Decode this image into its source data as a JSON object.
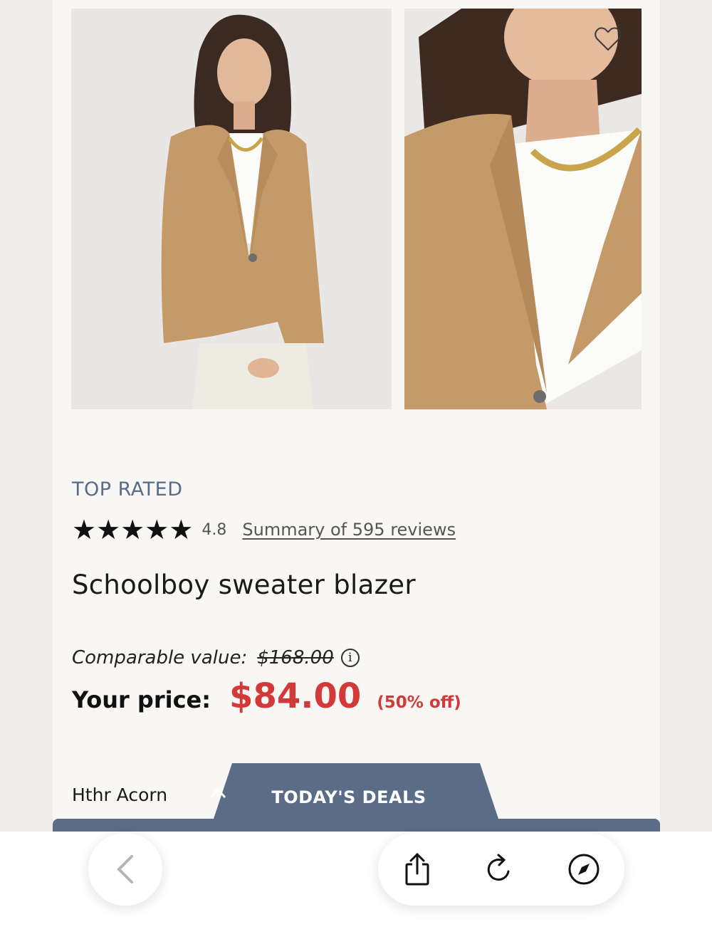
{
  "product": {
    "badge": "TOP RATED",
    "rating_value": "4.8",
    "stars": 5,
    "reviews_link": "Summary of 595 reviews",
    "title": "Schoolboy sweater blazer",
    "comparable_label": "Comparable value:",
    "comparable_price": "$168.00",
    "price_label": "Your price:",
    "price": "$84.00",
    "discount": "(50% off)",
    "color_name": "Hthr Acorn"
  },
  "deals": {
    "label": "TODAY'S DEALS"
  },
  "icons": {
    "favorite": "heart-icon",
    "info": "info-icon",
    "back": "chevron-left-icon",
    "share": "share-icon",
    "reload": "reload-icon",
    "compass": "compass-icon",
    "deals_toggle": "chevron-up-icon"
  },
  "colors": {
    "accent_blue": "#586b88",
    "sale_red": "#d23a3a",
    "blazer_camel": "#c49a68"
  }
}
